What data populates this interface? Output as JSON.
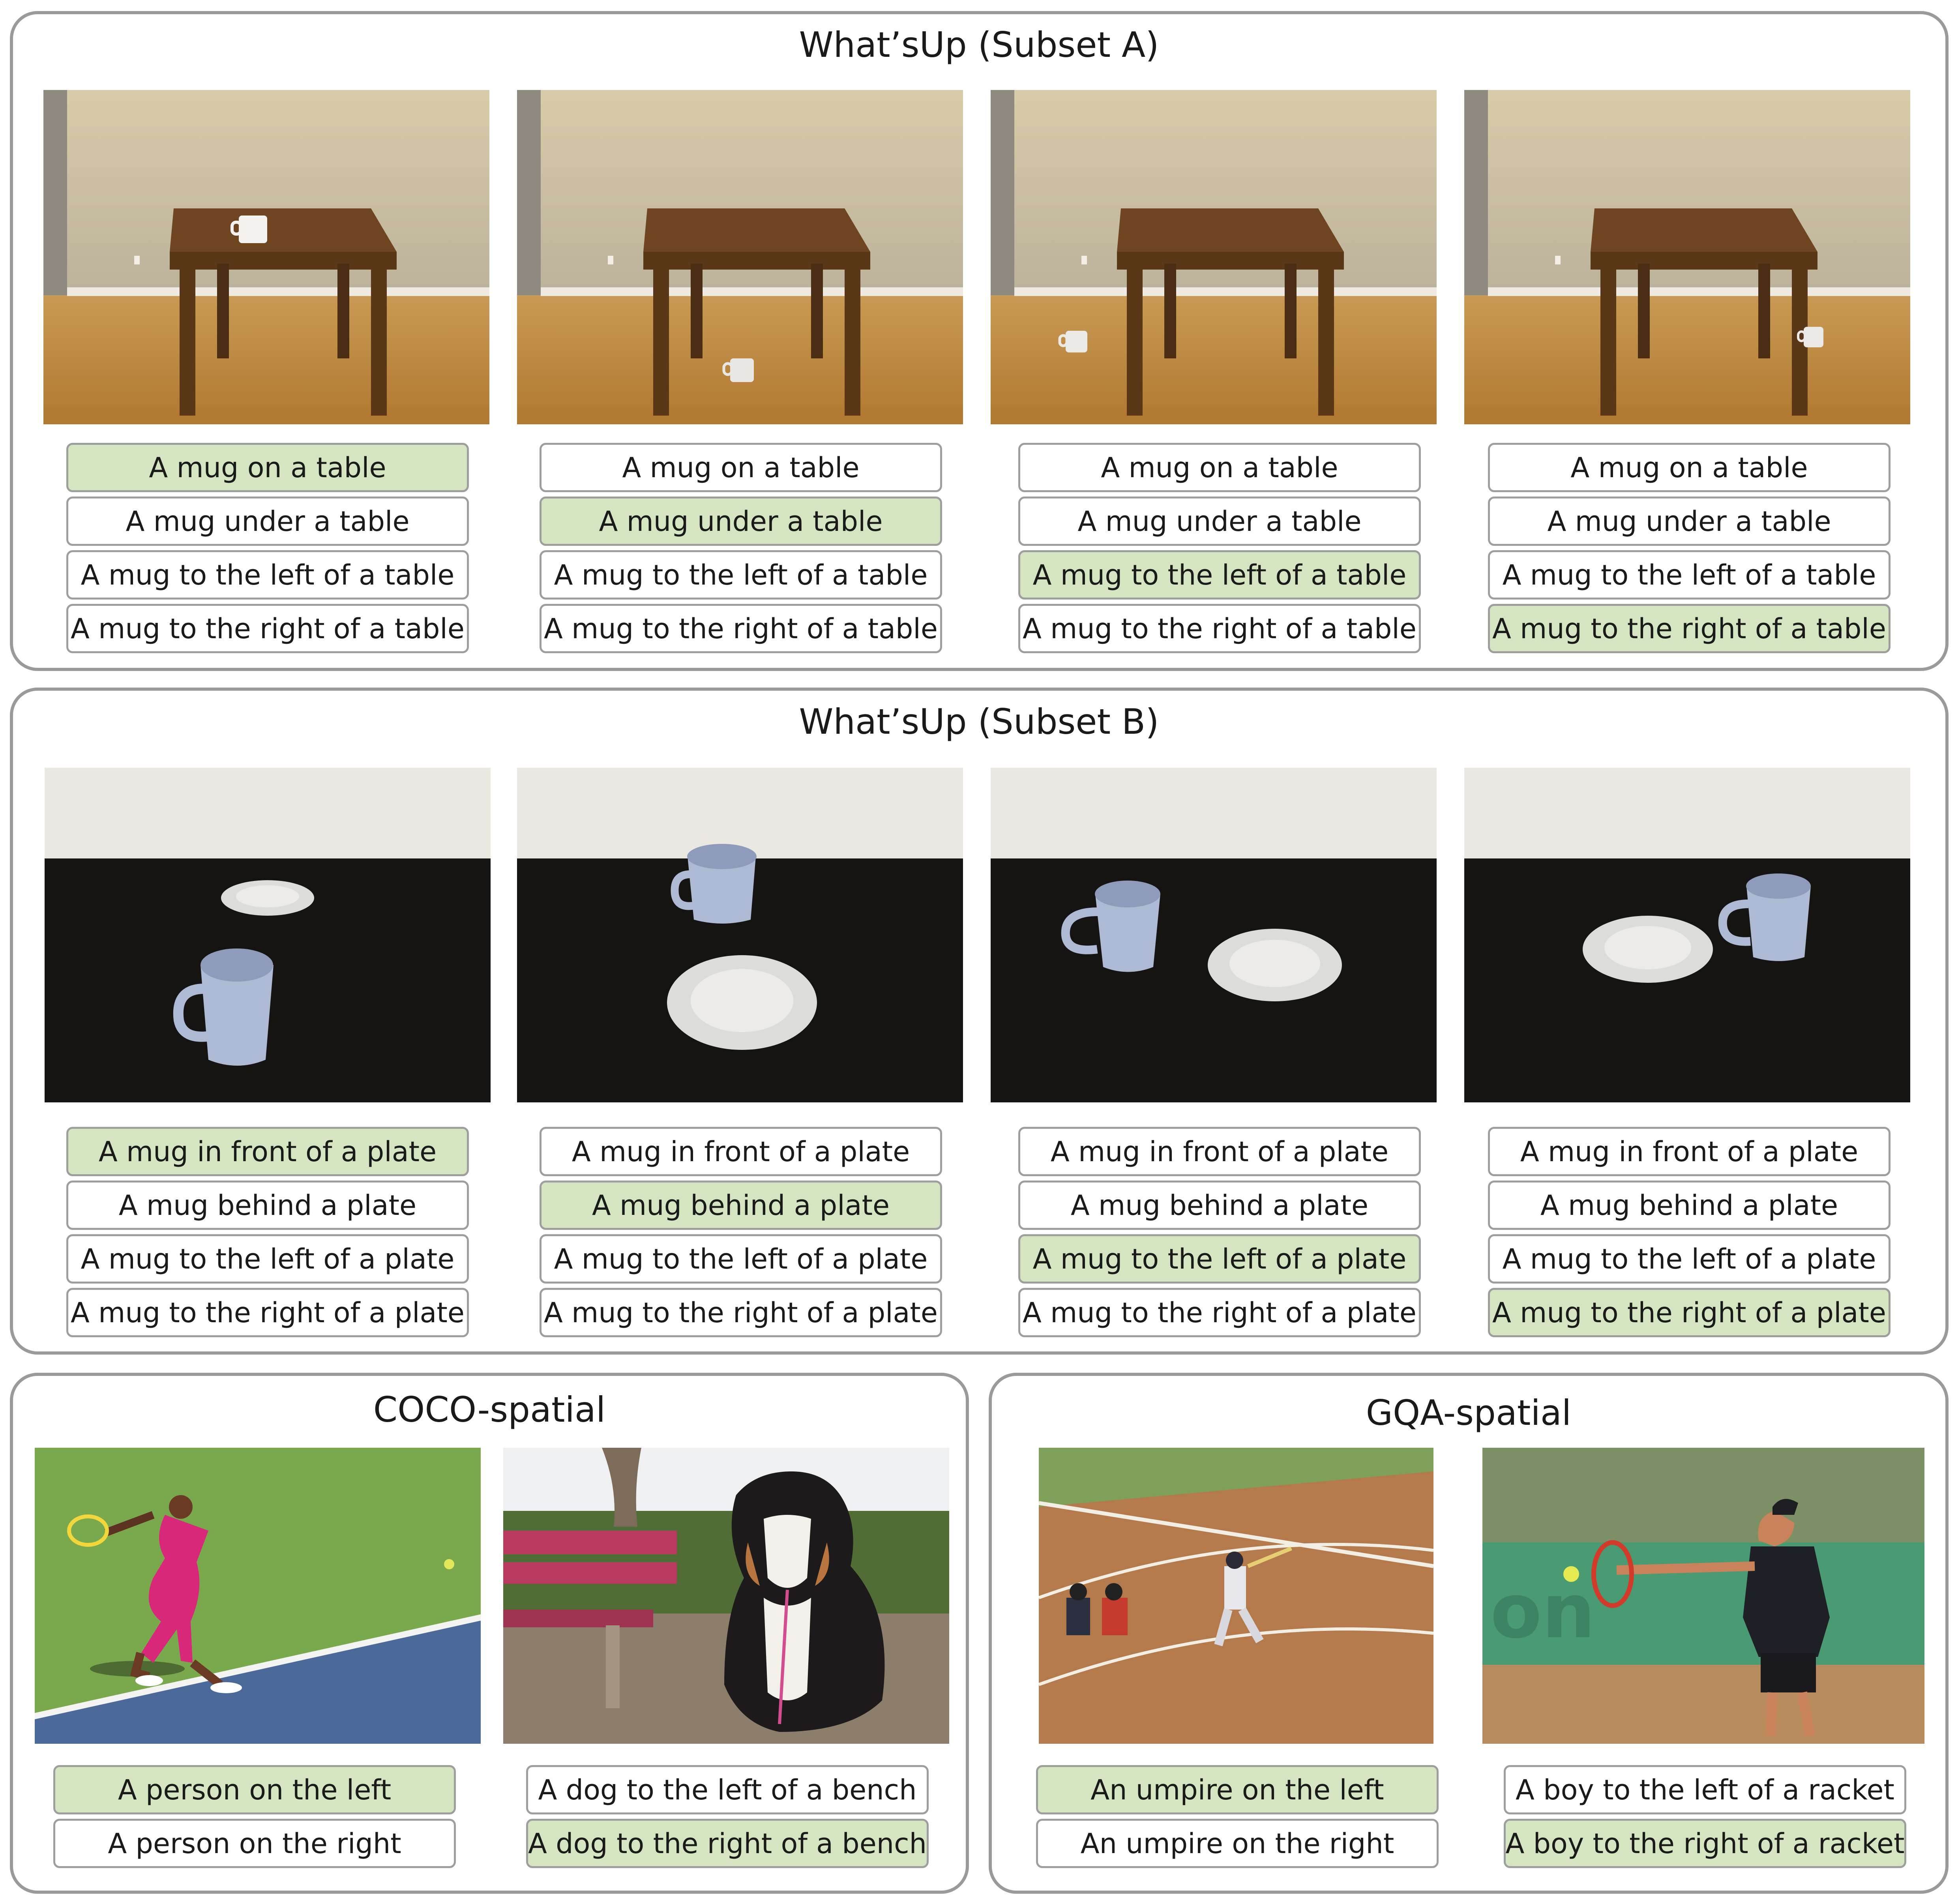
{
  "colors": {
    "correct_caption": "#d6e5c1",
    "panel_border": "#9a9a9a",
    "caption_border": "#9e9e9e"
  },
  "subset_a": {
    "title": "What’sUp (Subset A)",
    "captions": [
      "A mug on a table",
      "A mug under a table",
      "A mug to the left of a table",
      "A mug to the right of a table"
    ],
    "correct_index_per_image": [
      0,
      1,
      2,
      3
    ]
  },
  "subset_b": {
    "title": "What’sUp (Subset B)",
    "captions": [
      "A mug in front of a plate",
      "A mug behind a plate",
      "A mug to the left of a plate",
      "A mug to the right of a plate"
    ],
    "correct_index_per_image": [
      0,
      1,
      2,
      3
    ]
  },
  "coco": {
    "title": "COCO-spatial",
    "examples": [
      {
        "captions": [
          "A person on the left",
          "A person on the right"
        ],
        "correct_index": 0
      },
      {
        "captions": [
          "A dog to the left of a bench",
          "A dog to the right of a bench"
        ],
        "correct_index": 1
      }
    ]
  },
  "gqa": {
    "title": "GQA-spatial",
    "examples": [
      {
        "captions": [
          "An umpire on the left",
          "An umpire on the right"
        ],
        "correct_index": 0
      },
      {
        "captions": [
          "A boy to the left of a racket",
          "A boy to the right of a racket"
        ],
        "correct_index": 1
      }
    ]
  }
}
